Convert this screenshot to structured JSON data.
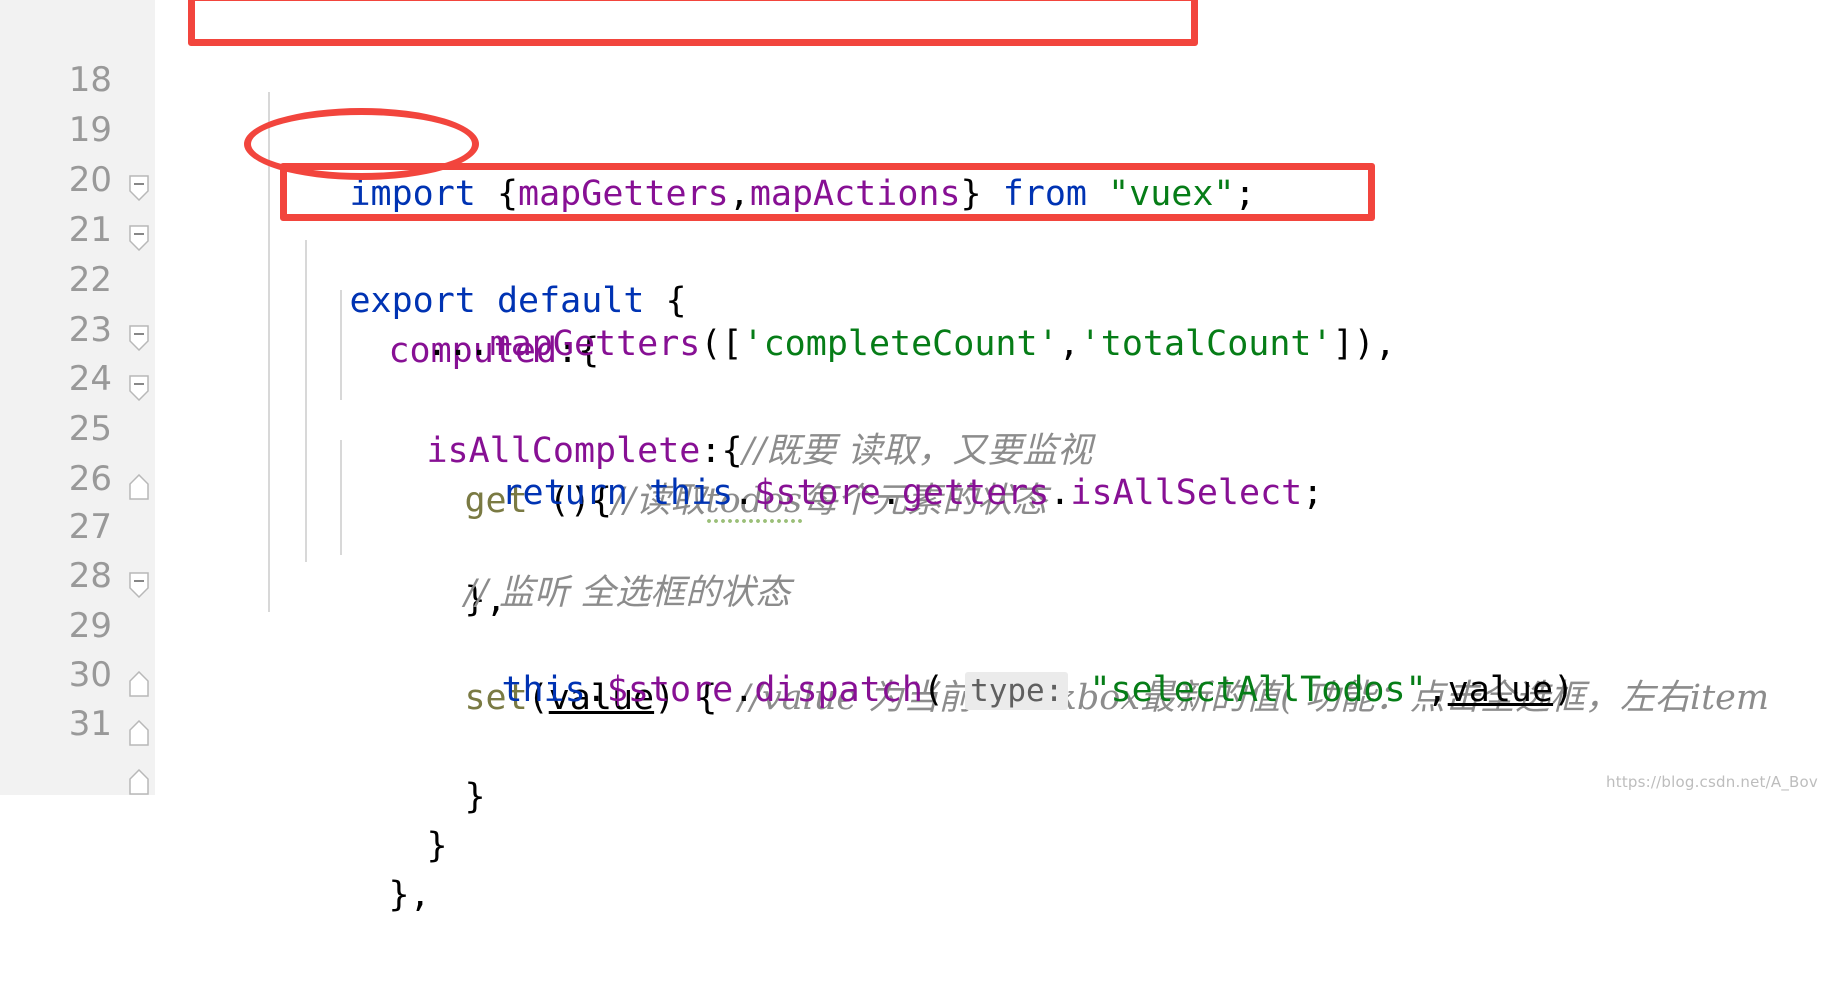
{
  "editor": {
    "gutter_bg": "#f2f2f2",
    "background": "#ffffff",
    "annotation_color": "#f2453d",
    "lines": [
      {
        "number": "18",
        "fold": "none"
      },
      {
        "number": "19",
        "fold": "collapse"
      },
      {
        "number": "20",
        "fold": "collapse"
      },
      {
        "number": "21",
        "fold": "none"
      },
      {
        "number": "22",
        "fold": "collapse"
      },
      {
        "number": "23",
        "fold": "collapse"
      },
      {
        "number": "24",
        "fold": "none"
      },
      {
        "number": "25",
        "fold": "end"
      },
      {
        "number": "26",
        "fold": "none"
      },
      {
        "number": "27",
        "fold": "collapse"
      },
      {
        "number": "28",
        "fold": "none"
      },
      {
        "number": "29",
        "fold": "end"
      },
      {
        "number": "30",
        "fold": "end"
      },
      {
        "number": "31",
        "fold": "end"
      }
    ]
  },
  "code": {
    "l18": {
      "kw_import": "import",
      "brace_open": " {",
      "id_mapGetters": "mapGetters",
      "comma": ",",
      "id_mapActions": "mapActions",
      "brace_close": "}",
      "kw_from": " from ",
      "str_vuex": "\"vuex\"",
      "semi": ";"
    },
    "l19": {
      "kw_export": "export",
      "kw_default": " default",
      "brace": " {"
    },
    "l20": {
      "ident": "computed",
      "punc": ":{"
    },
    "l21": {
      "spread": "...",
      "fn": "mapGetters",
      "open": "([",
      "str1": "'completeCount'",
      "comma": ",",
      "str2": "'totalCount'",
      "close": "]),"
    },
    "l22": {
      "ident": "isAllComplete",
      "punc": ":{",
      "comment": "//既要 读取，又要监视"
    },
    "l23": {
      "kw_get": "get",
      "punc": " (){",
      "comment_a": "//读取",
      "comment_todos": "todos",
      "comment_b": "每个元素的状态"
    },
    "l24": {
      "kw_return": "return",
      "kw_this": " this",
      "dot1": ".",
      "id_store": "$store",
      "dot2": ".",
      "id_getters": "getters",
      "dot3": ".",
      "id_isAllSelect": "isAllSelect",
      "semi": ";"
    },
    "l25": {
      "text": "},"
    },
    "l26": {
      "comment": "// 监听 全选框的状态"
    },
    "l27": {
      "fn": "set",
      "paren_open": "(",
      "param": "value",
      "paren_close": ")",
      "brace": " { ",
      "comment_a": "//value",
      "comment_b": " 为当前",
      "comment_checkbox": "checkbox",
      "comment_c": "最新的值( 功能：点击全选框，左右",
      "comment_item": "item"
    },
    "l28": {
      "kw_this": "this",
      "dot1": ".",
      "id_store": "$store",
      "dot2": ".",
      "fn_dispatch": "dispatch",
      "paren": "( ",
      "hint_type": "type:",
      "str": " \"selectAllTodos\"",
      "comma": ",",
      "param": "value",
      "paren_close": ")"
    },
    "l29": {
      "text": "}"
    },
    "l30": {
      "text": "}"
    },
    "l31": {
      "text": "},"
    }
  },
  "annotations": [
    {
      "name": "red-box-import",
      "shape": "rect",
      "label": "import line highlight"
    },
    {
      "name": "red-ellipse-computed",
      "shape": "ellipse",
      "label": "computed key highlight"
    },
    {
      "name": "red-box-mapgetters",
      "shape": "rect",
      "label": "mapGetters spread highlight"
    }
  ],
  "watermark": {
    "text": "https://blog.csdn.net/A_Bov"
  }
}
